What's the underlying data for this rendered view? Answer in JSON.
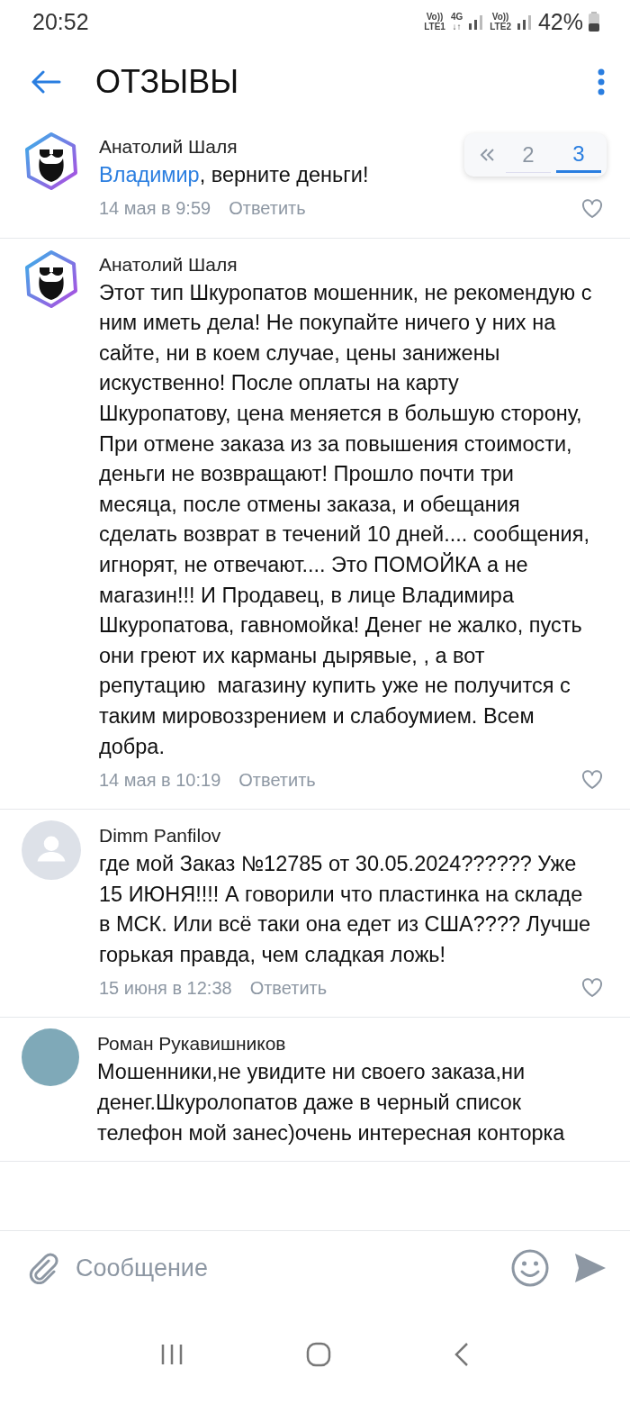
{
  "status_bar": {
    "time": "20:52",
    "sim1": [
      "Vo))",
      "LTE1"
    ],
    "network": [
      "4G",
      "↓↑"
    ],
    "sim2": [
      "Vo))",
      "LTE2"
    ],
    "battery": "42%"
  },
  "header": {
    "title": "ОТЗЫВЫ"
  },
  "pagination": {
    "pages": [
      {
        "label": "2",
        "selected": false
      },
      {
        "label": "3",
        "selected": true
      }
    ]
  },
  "comments": [
    {
      "author": "Анатолий Шаля",
      "kind": "logo",
      "mention": "Владимир",
      "text": ", верните деньги!",
      "date": "14 мая в 9:59",
      "reply": "Ответить"
    },
    {
      "author": "Анатолий Шаля",
      "kind": "logo",
      "text": "Этот тип Шкуропатов мошенник, не рекомендую с ним иметь дела! Не покупайте ничего у них на сайте, ни в коем случае, цены занижены искуственно! После оплаты на карту Шкуропатову, цена меняется в большую сторону, При отмене заказа из за повышения стоимости, деньги не возвращают! Прошло почти три месяца, после отмены заказа, и обещания сделать возврат в течений 10 дней.... сообщения, игнорят, не отвечают.... Это ПОМОЙКА а не магазин!!! И Продавец, в лице Владимира Шкуропатова, гавномойка! Денег не жалко, пусть они греют их карманы дырявые, , а вот репутацию  магазину купить уже не получится с таким мировоззрением и слабоумием. Всем добра.",
      "date": "14 мая в 10:19",
      "reply": "Ответить"
    },
    {
      "author": "Dimm Panfilov",
      "kind": "placeholder",
      "text": "где мой Заказ №12785 от 30.05.2024?????? Уже 15 ИЮНЯ!!!! А говорили что пластинка на складе в МСК. Или всё таки она едет из США???? Лучше горькая правда, чем сладкая ложь!",
      "date": "15 июня в 12:38",
      "reply": "Ответить"
    },
    {
      "author": "Роман Рукавишников",
      "kind": "photo",
      "text": "Мошенники,не увидите ни своего заказа,ни денег.Шкуролопатов даже в черный список телефон мой занес)очень интересная конторка"
    }
  ],
  "composer": {
    "placeholder": "Сообщение"
  }
}
